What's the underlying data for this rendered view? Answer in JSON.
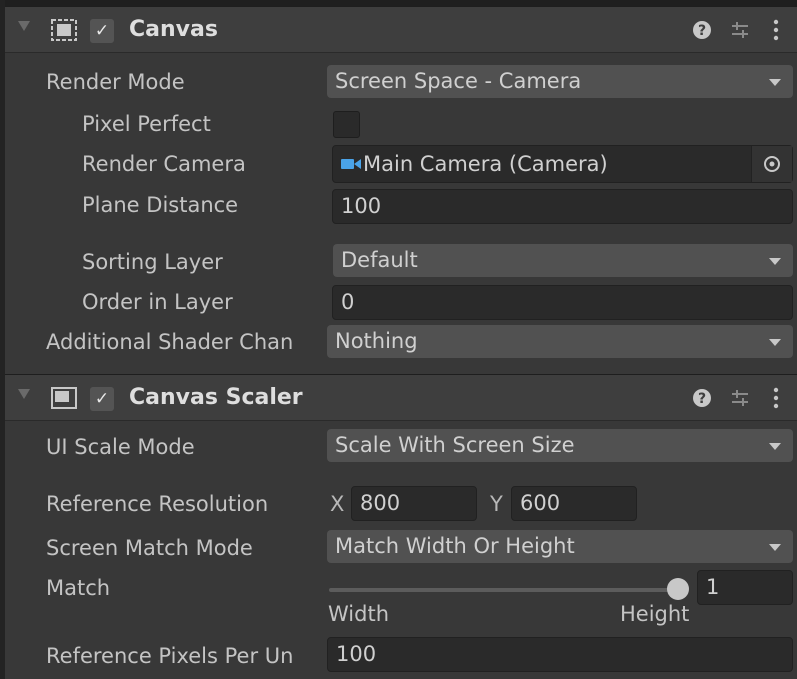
{
  "canvas": {
    "title": "Canvas",
    "enabled": true,
    "rows": {
      "render_mode": {
        "label": "Render Mode",
        "value": "Screen Space - Camera"
      },
      "pixel_perfect": {
        "label": "Pixel Perfect",
        "checked": false
      },
      "render_camera": {
        "label": "Render Camera",
        "value": "Main Camera (Camera)"
      },
      "plane_distance": {
        "label": "Plane Distance",
        "value": "100"
      },
      "sorting_layer": {
        "label": "Sorting Layer",
        "value": "Default"
      },
      "order_in_layer": {
        "label": "Order in Layer",
        "value": "0"
      },
      "shader_channels": {
        "label": "Additional Shader Chan",
        "value": "Nothing"
      }
    }
  },
  "canvas_scaler": {
    "title": "Canvas Scaler",
    "enabled": true,
    "rows": {
      "ui_scale_mode": {
        "label": "UI Scale Mode",
        "value": "Scale With Screen Size"
      },
      "reference_resolution": {
        "label": "Reference Resolution",
        "x_label": "X",
        "x": "800",
        "y_label": "Y",
        "y": "600"
      },
      "screen_match_mode": {
        "label": "Screen Match Mode",
        "value": "Match Width Or Height"
      },
      "match": {
        "label": "Match",
        "value": "1",
        "min_label": "Width",
        "max_label": "Height",
        "slider_fraction": 1
      },
      "ref_pixels": {
        "label": "Reference Pixels Per Un",
        "value": "100"
      }
    }
  },
  "icons": {
    "fold": "triangle-down-icon",
    "help": "help-icon",
    "presets": "presets-icon",
    "menu": "kebab-menu-icon",
    "camera": "camera-icon",
    "object_picker": "object-picker-icon"
  },
  "colors": {
    "panel_bg": "#383838",
    "header_bg": "#3e3e3e",
    "dropdown_bg": "#515151",
    "field_bg": "#2a2a2a",
    "camera_icon": "#4aa3e8"
  }
}
